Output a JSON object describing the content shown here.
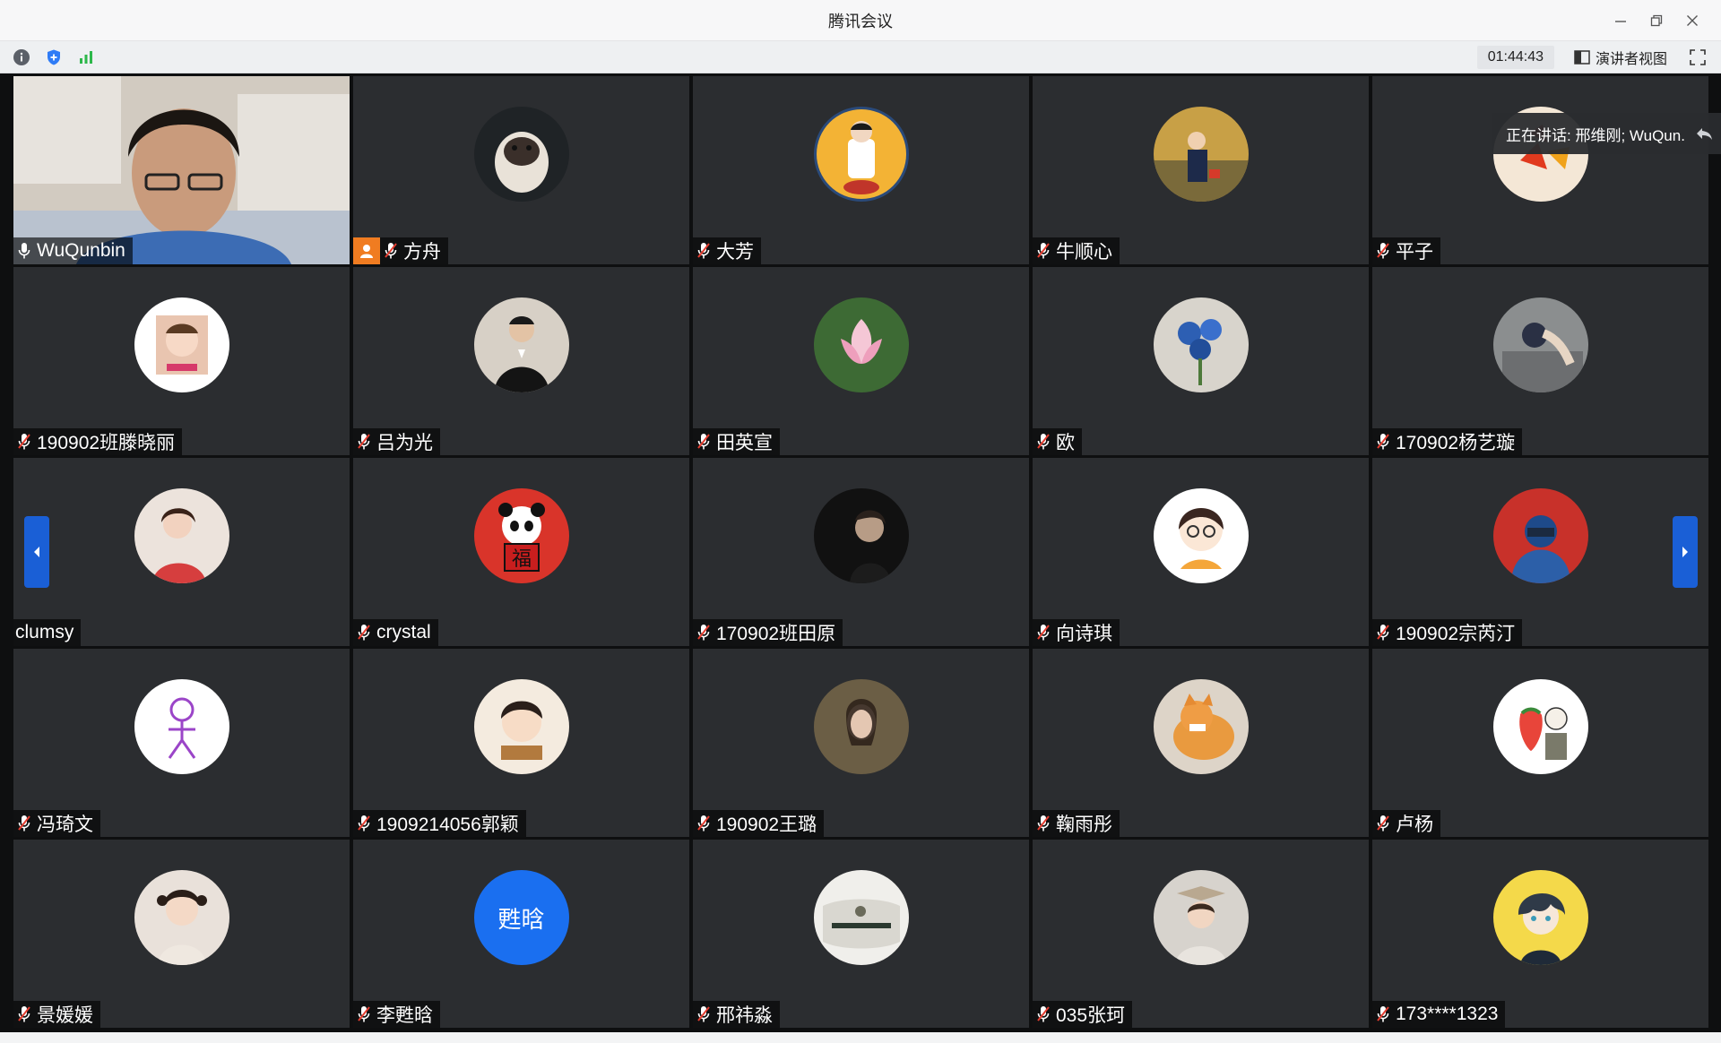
{
  "window": {
    "title": "腾讯会议"
  },
  "toolbar": {
    "timer": "01:44:43",
    "speaker_view_label": "演讲者视图"
  },
  "speaking": {
    "text": "正在讲话: 邢维刚; WuQun.."
  },
  "colors": {
    "accent": "#1a6ff0",
    "host": "#f07c21",
    "tile_bg": "#2b2d30",
    "stage_bg": "#0e0f10"
  },
  "participants": [
    {
      "name": "WuQunbin",
      "mic": "on",
      "video": true
    },
    {
      "name": "方舟",
      "mic": "muted",
      "host": true,
      "avatar": "pug"
    },
    {
      "name": "大芳",
      "mic": "muted",
      "avatar": "character"
    },
    {
      "name": "牛顺心",
      "mic": "muted",
      "avatar": "child-photo"
    },
    {
      "name": "平子",
      "mic": "muted",
      "avatar": "leaves"
    },
    {
      "name": "190902班滕晓丽",
      "mic": "muted",
      "avatar": "baby"
    },
    {
      "name": "吕为光",
      "mic": "muted",
      "avatar": "man-suit"
    },
    {
      "name": "田英宣",
      "mic": "muted",
      "avatar": "lotus"
    },
    {
      "name": "欧",
      "mic": "muted",
      "avatar": "blue-flower"
    },
    {
      "name": "170902杨艺璇",
      "mic": "muted",
      "avatar": "lying-person"
    },
    {
      "name": "clumsy",
      "mic": "none",
      "avatar": "girl-red"
    },
    {
      "name": "crystal",
      "mic": "muted",
      "avatar": "panda-fu"
    },
    {
      "name": "170902班田原",
      "mic": "muted",
      "avatar": "dark-portrait"
    },
    {
      "name": "向诗琪",
      "mic": "muted",
      "avatar": "cartoon-girl"
    },
    {
      "name": "190902宗芮汀",
      "mic": "muted",
      "avatar": "blue-hood"
    },
    {
      "name": "冯琦文",
      "mic": "muted",
      "avatar": "doodle-person"
    },
    {
      "name": "1909214056郭颖",
      "mic": "muted",
      "avatar": "cartoon-boy"
    },
    {
      "name": "190902王璐",
      "mic": "muted",
      "avatar": "drawn-woman"
    },
    {
      "name": "鞠雨彤",
      "mic": "muted",
      "avatar": "cat"
    },
    {
      "name": "卢杨",
      "mic": "muted",
      "avatar": "strawberry"
    },
    {
      "name": "景媛媛",
      "mic": "muted",
      "avatar": "little-girl"
    },
    {
      "name": "李甦晗",
      "mic": "muted",
      "avatar_text": "甦晗"
    },
    {
      "name": "邢祎淼",
      "mic": "muted",
      "avatar": "pillow"
    },
    {
      "name": "035张珂",
      "mic": "muted",
      "avatar": "woman-book"
    },
    {
      "name": "173****1323",
      "mic": "muted",
      "avatar": "anime-boy"
    }
  ]
}
